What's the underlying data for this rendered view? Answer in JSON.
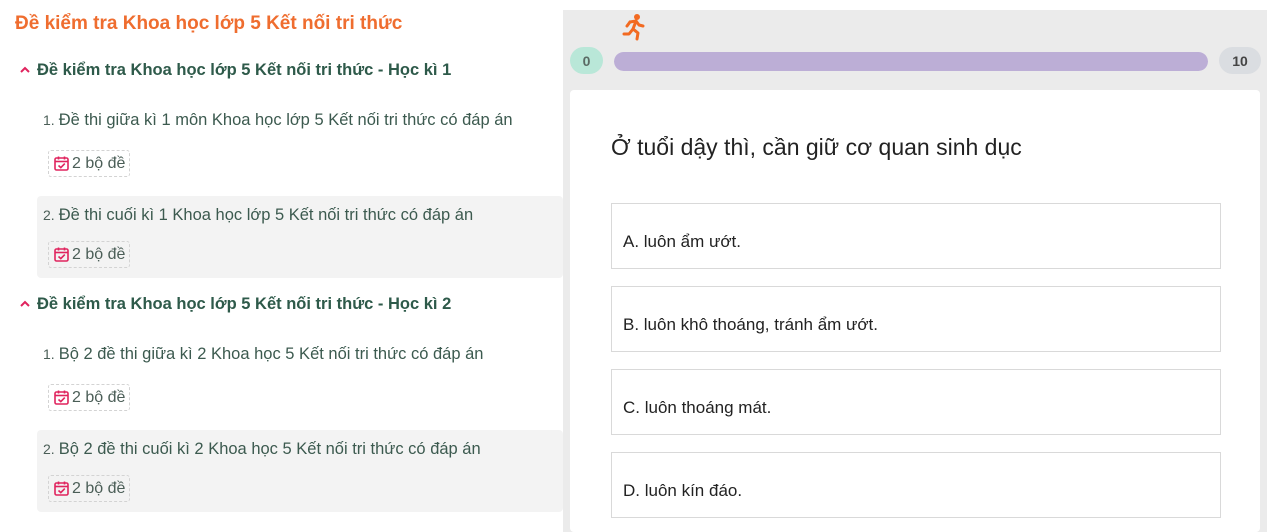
{
  "left": {
    "title": "Đề kiểm tra Khoa học lớp 5 Kết nối tri thức",
    "sections": [
      {
        "title": "Đề kiểm tra Khoa học lớp 5 Kết nối tri thức - Học kì 1",
        "items": [
          {
            "num": "1.",
            "title": "Đề thi giữa kì 1 môn Khoa học lớp 5 Kết nối tri thức có đáp án",
            "badge": "2 bộ đề"
          },
          {
            "num": "2.",
            "title": "Đề thi cuối kì 1 Khoa học lớp 5 Kết nối tri thức có đáp án",
            "badge": "2 bộ đề"
          }
        ]
      },
      {
        "title": "Đề kiểm tra Khoa học lớp 5 Kết nối tri thức - Học kì 2",
        "items": [
          {
            "num": "1.",
            "title": "Bộ 2 đề thi giữa kì 2 Khoa học 5 Kết nối tri thức có đáp án",
            "badge": "2 bộ đề"
          },
          {
            "num": "2.",
            "title": "Bộ 2 đề thi cuối kì 2 Khoa học 5 Kết nối tri thức có đáp án",
            "badge": "2 bộ đề"
          }
        ]
      }
    ]
  },
  "quiz": {
    "progress": {
      "start": "0",
      "end": "10",
      "fill_fraction": 1.0
    },
    "question": "Ở tuổi dậy thì, cần giữ cơ quan sinh dục",
    "options": [
      "A. luôn ẩm ướt.",
      "B. luôn khô thoáng, tránh ẩm ướt.",
      "C. luôn thoáng mát.",
      "D. luôn kín đáo."
    ]
  },
  "icons": {
    "section_toggle": "chevron-up-icon",
    "badge": "calendar-check-icon",
    "progress_marker": "runner-icon"
  },
  "colors": {
    "title": "#ef6d2f",
    "section": "#2e5a4a",
    "badge_icon": "#e0245e",
    "progress_fill": "#bcaed6",
    "runner": "#f26a21"
  }
}
